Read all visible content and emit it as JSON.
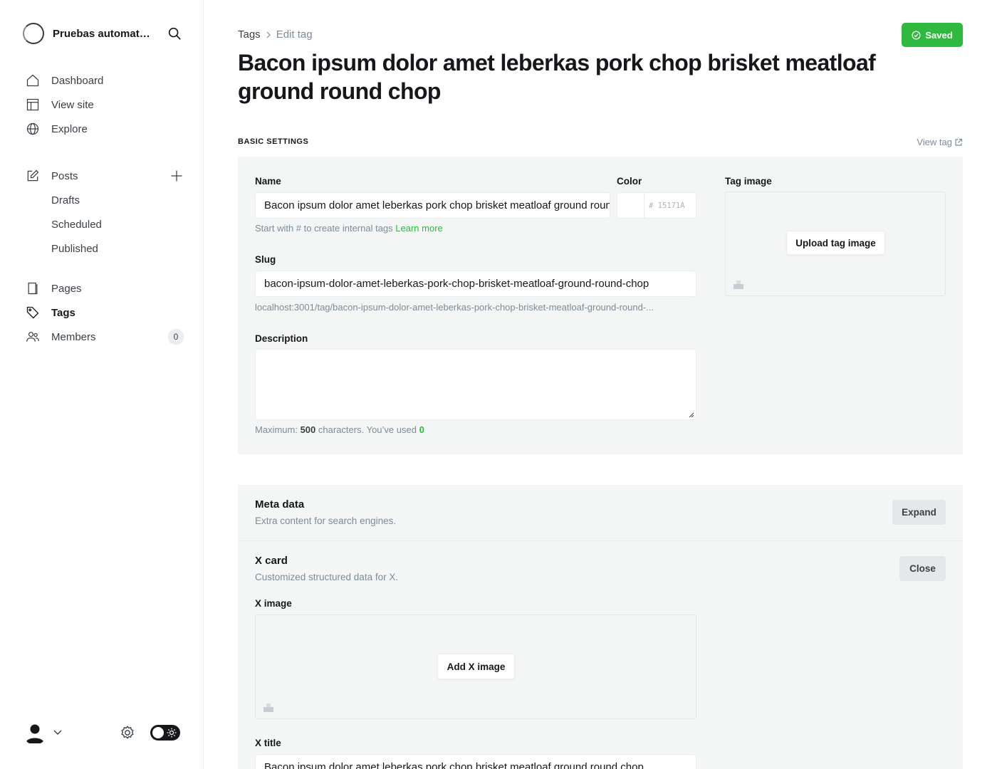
{
  "sidebar": {
    "brand": "Pruebas automatizadas",
    "nav": [
      {
        "label": "Dashboard",
        "icon": "home-icon"
      },
      {
        "label": "View site",
        "icon": "layout-icon"
      },
      {
        "label": "Explore",
        "icon": "globe-icon"
      }
    ],
    "posts": {
      "label": "Posts",
      "icon": "edit-icon",
      "sub": [
        "Drafts",
        "Scheduled",
        "Published"
      ]
    },
    "nav2": [
      {
        "label": "Pages",
        "icon": "page-icon"
      },
      {
        "label": "Tags",
        "icon": "tag-icon"
      },
      {
        "label": "Members",
        "icon": "members-icon",
        "badge": "0"
      }
    ]
  },
  "breadcrumb": {
    "root": "Tags",
    "current": "Edit tag"
  },
  "saved_label": "Saved",
  "title": "Bacon ipsum dolor amet leberkas pork chop brisket meatloaf ground round chop",
  "section_heading": "BASIC SETTINGS",
  "view_tag": "View tag",
  "form": {
    "name_label": "Name",
    "name_value": "Bacon ipsum dolor amet leberkas pork chop brisket meatloaf ground round chop",
    "name_hint": "Start with # to create internal tags",
    "learn_more": "Learn more",
    "color_label": "Color",
    "color_value": "# 15171A",
    "tag_image_label": "Tag image",
    "upload_label": "Upload tag image",
    "slug_label": "Slug",
    "slug_value": "bacon-ipsum-dolor-amet-leberkas-pork-chop-brisket-meatloaf-ground-round-chop",
    "slug_url": "localhost:3001/tag/bacon-ipsum-dolor-amet-leberkas-pork-chop-brisket-meatloaf-ground-round-...",
    "description_label": "Description",
    "max_prefix": "Maximum:",
    "max_count": "500",
    "max_middle": "characters. You’ve used",
    "used_count": "0"
  },
  "meta": {
    "title": "Meta data",
    "sub": "Extra content for search engines.",
    "button": "Expand"
  },
  "xcard": {
    "title": "X card",
    "sub": "Customized structured data for X.",
    "button": "Close",
    "image_label": "X image",
    "add_image": "Add X image",
    "title_label": "X title",
    "title_value": "Bacon ipsum dolor amet leberkas pork chop brisket meatloaf ground round chop"
  },
  "colors": {
    "accent": "#30cf43",
    "text": "#15171a",
    "muted": "#7c8b9a",
    "panel": "#f4f5f5"
  }
}
